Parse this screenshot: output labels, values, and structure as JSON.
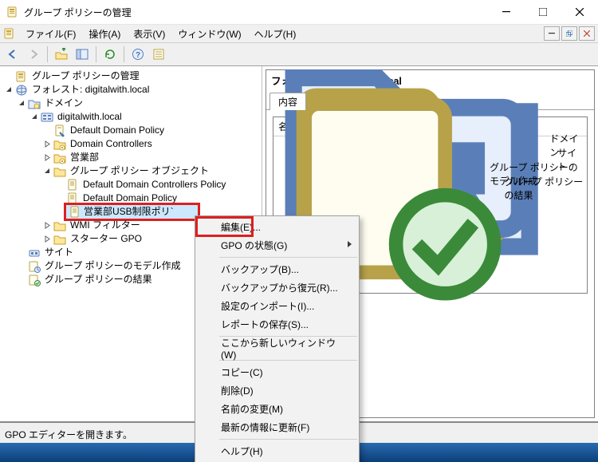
{
  "title": "グループ ポリシーの管理",
  "menubar": {
    "file": "ファイル(F)",
    "action": "操作(A)",
    "view": "表示(V)",
    "window": "ウィンドウ(W)",
    "help": "ヘルプ(H)"
  },
  "tree": {
    "root": "グループ ポリシーの管理",
    "forest": "フォレスト: digitalwith.local",
    "domains": "ドメイン",
    "domain": "digitalwith.local",
    "ddp": "Default Domain Policy",
    "dc": "Domain Controllers",
    "ou_sales": "営業部",
    "gpo_folder": "グループ ポリシー オブジェクト",
    "ddcp": "Default Domain Controllers Policy",
    "ddp2": "Default Domain Policy",
    "sales_usb": "営業部USB制限ポリ`",
    "wmi": "WMI フィルター",
    "starter": "スターター GPO",
    "sites": "サイト",
    "modeling": "グループ ポリシーのモデル作成",
    "results": "グループ ポリシーの結果"
  },
  "detail": {
    "header": "フォレスト:  digitalwith.local",
    "tab_contents": "内容",
    "col_name": "名前",
    "items": {
      "domains": "ドメイン",
      "sites": "サイト",
      "modeling": "グループ ポリシーのモデル作成",
      "results": "グループ ポリシーの結果"
    }
  },
  "context_menu": {
    "edit": "編集(E)...",
    "gpo_status": "GPO の状態(G)",
    "backup": "バックアップ(B)...",
    "restore": "バックアップから復元(R)...",
    "import": "設定のインポート(I)...",
    "save_report": "レポートの保存(S)...",
    "new_window": "ここから新しいウィンドウ(W)",
    "copy": "コピー(C)",
    "delete": "削除(D)",
    "rename": "名前の変更(M)",
    "refresh": "最新の情報に更新(F)",
    "help": "ヘルプ(H)"
  },
  "status": "GPO エディターを開きます。"
}
